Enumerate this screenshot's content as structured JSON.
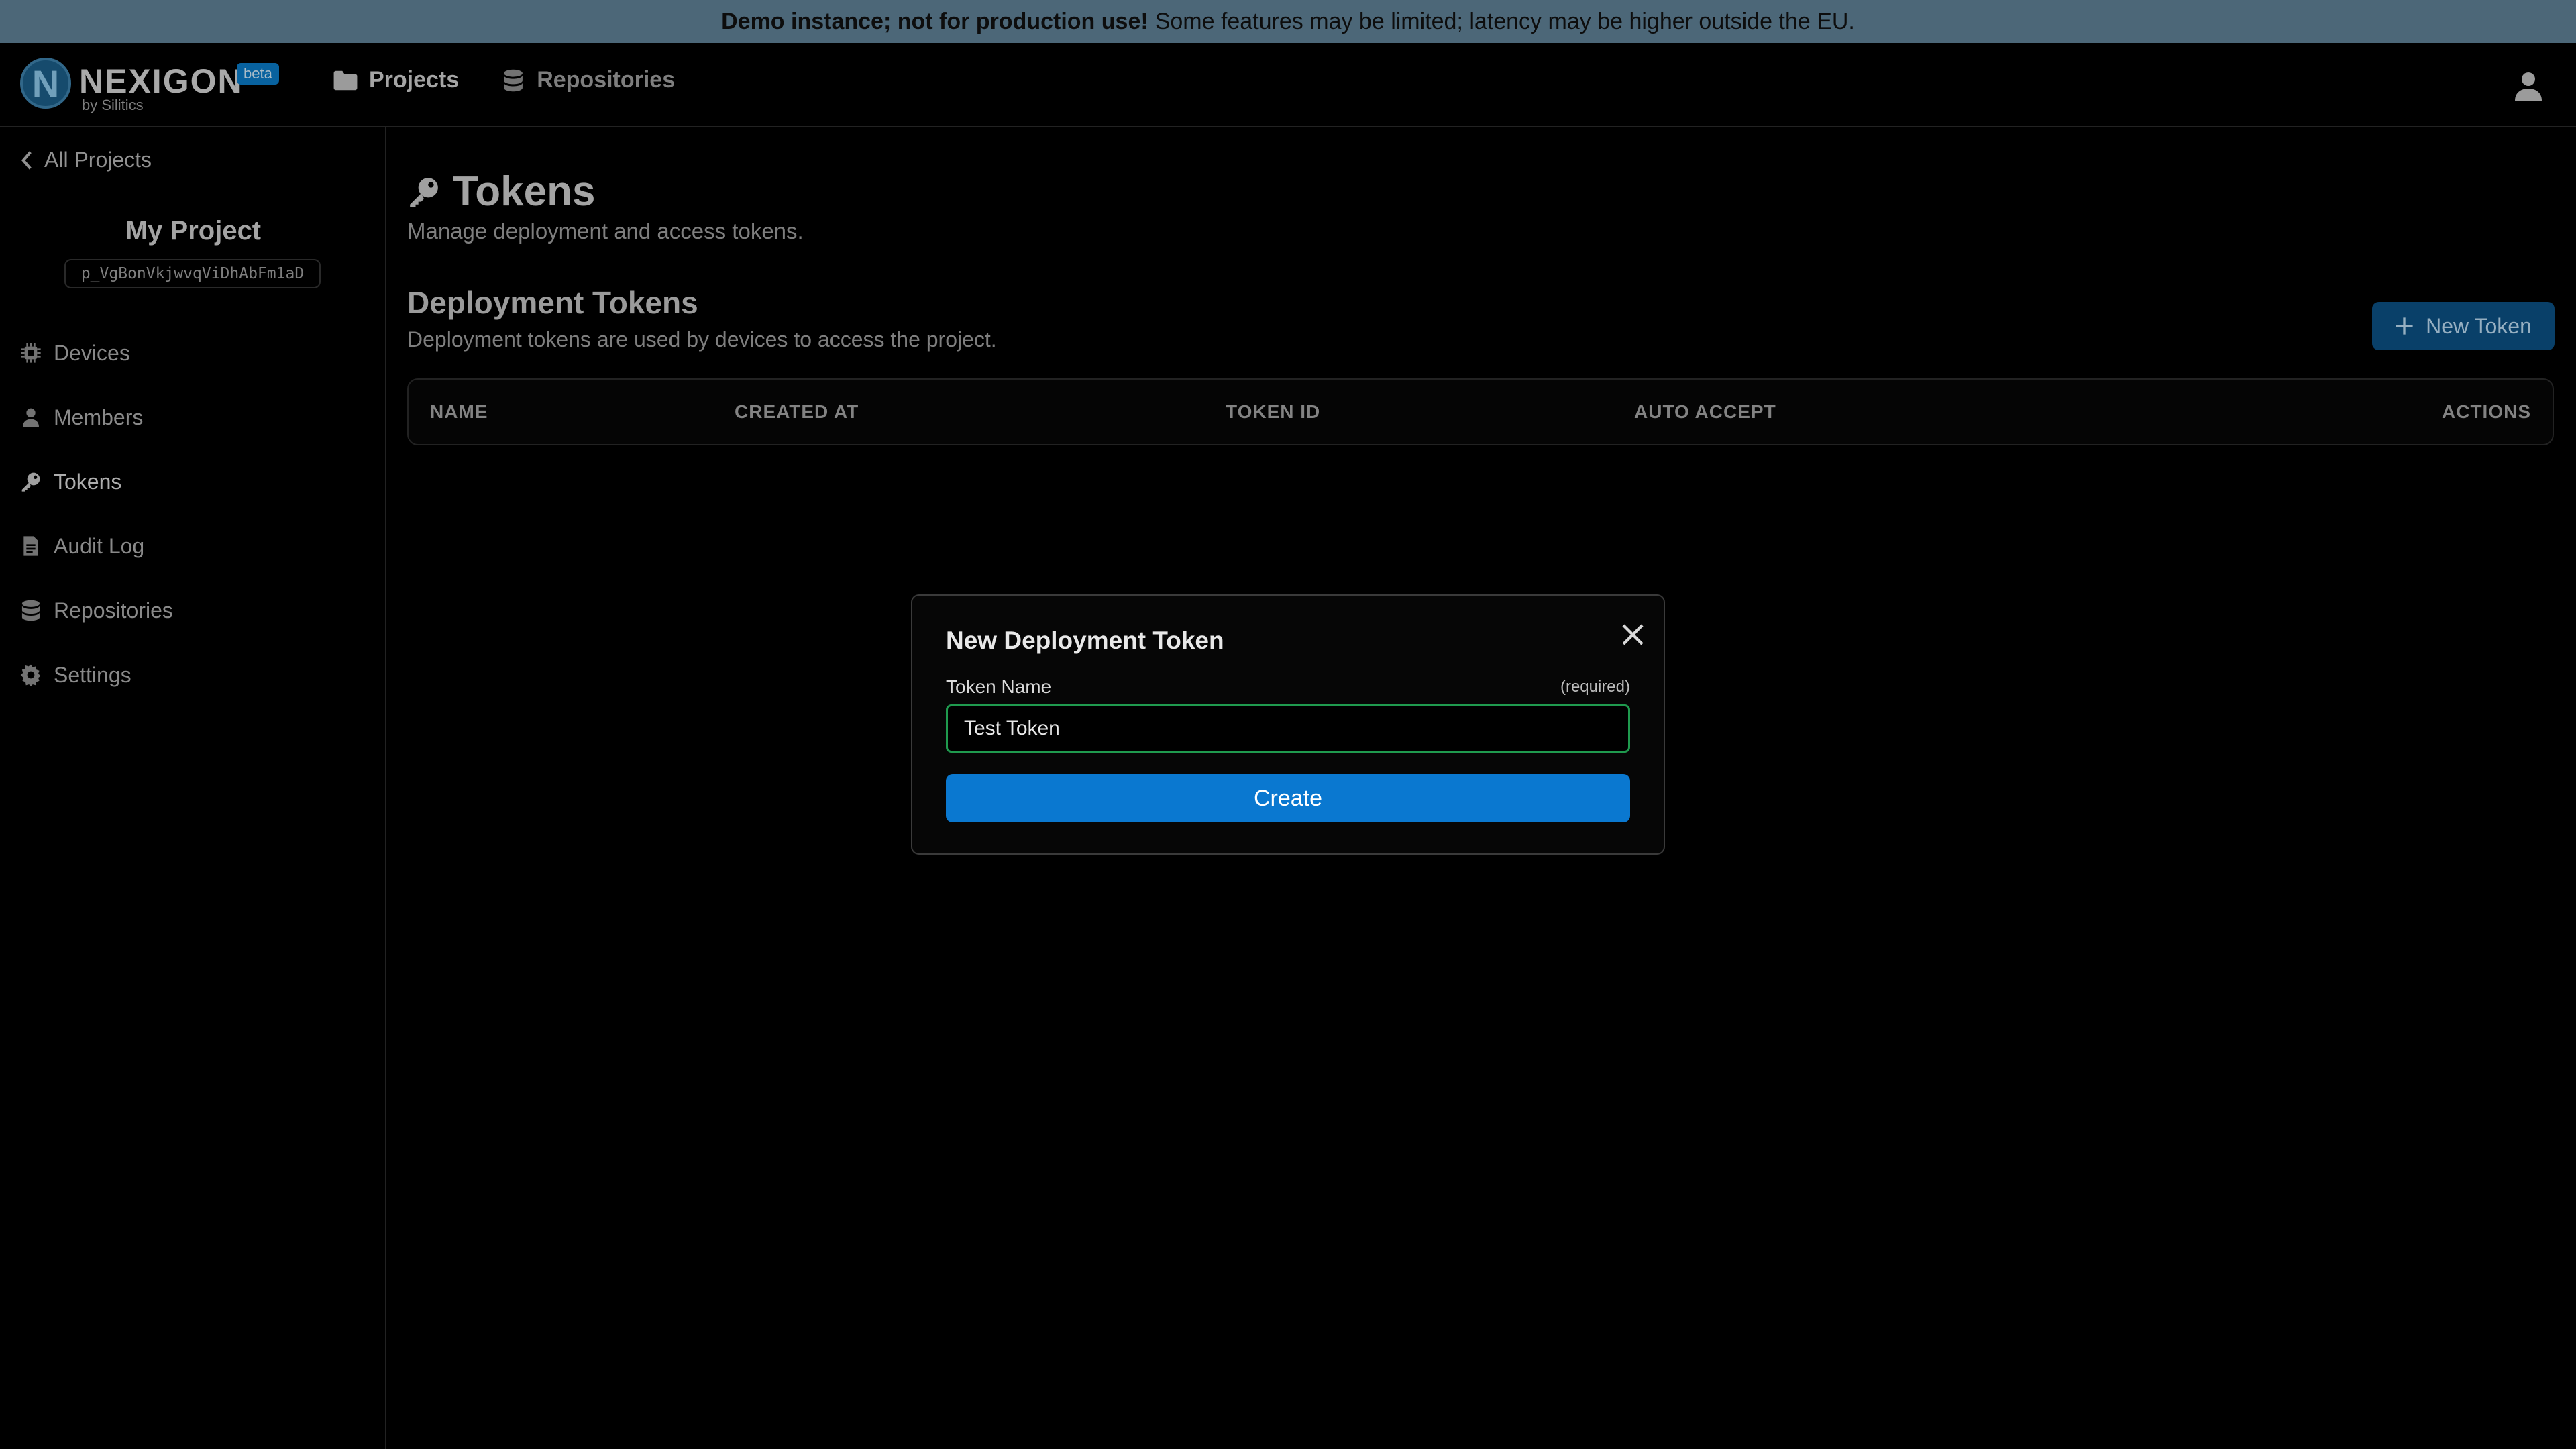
{
  "banner": {
    "bold": "Demo instance; not for production use!",
    "text": "Some features may be limited; latency may be higher outside the EU."
  },
  "header": {
    "logo_word": "NEXIGON",
    "logo_by": "by Silitics",
    "logo_badge": "beta",
    "logo_letter": "N",
    "nav": {
      "projects": "Projects",
      "repositories": "Repositories"
    }
  },
  "sidebar": {
    "back": "All Projects",
    "project_name": "My Project",
    "project_id": "p_VgBonVkjwvqViDhAbFm1aD",
    "items": [
      {
        "label": "Devices",
        "icon": "chip-icon"
      },
      {
        "label": "Members",
        "icon": "user-icon"
      },
      {
        "label": "Tokens",
        "icon": "key-icon",
        "active": true
      },
      {
        "label": "Audit Log",
        "icon": "document-icon"
      },
      {
        "label": "Repositories",
        "icon": "database-icon"
      },
      {
        "label": "Settings",
        "icon": "gear-icon"
      }
    ]
  },
  "main": {
    "title": "Tokens",
    "subtitle": "Manage deployment and access tokens.",
    "section_title": "Deployment Tokens",
    "section_subtitle": "Deployment tokens are used by devices to access the project.",
    "new_token_label": "New Token",
    "table": {
      "columns": [
        "NAME",
        "CREATED AT",
        "TOKEN ID",
        "AUTO ACCEPT",
        "ACTIONS"
      ]
    }
  },
  "modal": {
    "title": "New Deployment Token",
    "field_label": "Token Name",
    "field_required": "(required)",
    "field_value": "Test Token",
    "submit_label": "Create"
  },
  "colors": {
    "accent": "#0a78d0",
    "input_focus": "#1f9a4e",
    "banner_bg": "#5d7e93"
  }
}
